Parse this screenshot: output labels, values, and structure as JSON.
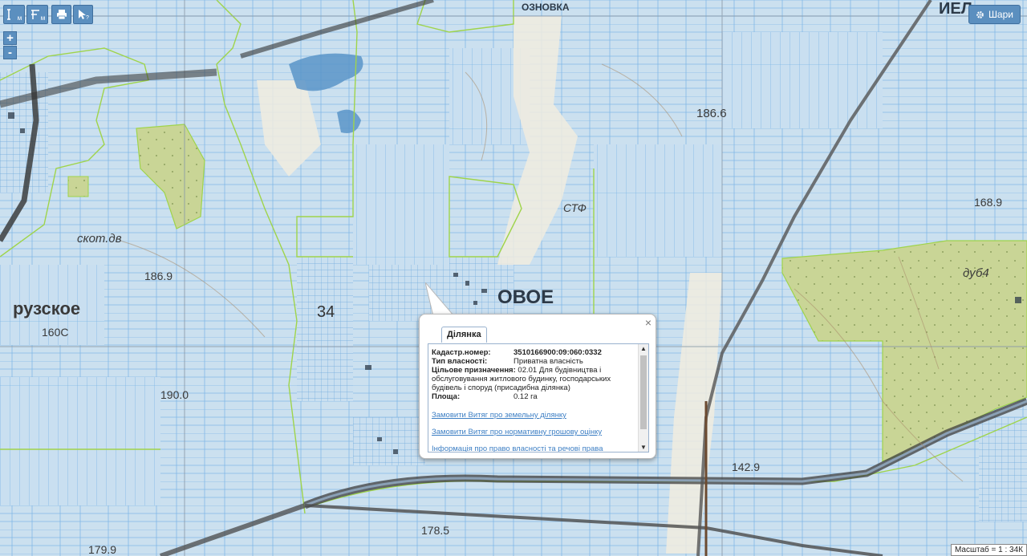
{
  "toolbar": {
    "measure_length_label": "м",
    "measure_area_label": "м",
    "icons": [
      "ruler-icon",
      "area-ruler-icon",
      "print-icon",
      "identify-icon"
    ]
  },
  "zoom": {
    "in_label": "+",
    "out_label": "-"
  },
  "layers_button": {
    "label": "Шари",
    "icon": "gear-icon"
  },
  "map_labels": [
    {
      "text": "рузское"
    },
    {
      "text": "160С"
    },
    {
      "text": "186.9"
    },
    {
      "text": "190.0"
    },
    {
      "text": "179.9"
    },
    {
      "text": "178.5"
    },
    {
      "text": "186.6"
    },
    {
      "text": "168.9"
    },
    {
      "text": "дуб4"
    },
    {
      "text": "142.9"
    },
    {
      "text": "ОВОЕ"
    },
    {
      "text": "34"
    },
    {
      "text": "СТФ"
    },
    {
      "text": "скот.дв"
    },
    {
      "text": "ИЕЛ"
    },
    {
      "text": "ОЗНОВКА"
    }
  ],
  "popup": {
    "tab_label": "Ділянка",
    "close_label": "×",
    "cadastral_label": "Кадастр.номер:",
    "cadastral_value": "3510166900:09:060:0332",
    "ownership_label": "Тип власності:",
    "ownership_value": "Приватна власність",
    "purpose_label": "Цільове призначення:",
    "purpose_value": "02.01 Для будівництва і обслуговування житлового будинку, господарських будівель і споруд (присадибна ділянка)",
    "area_label": "Площа:",
    "area_value": "0.12 га",
    "links": [
      "Замовити Витяг про земельну ділянку",
      "Замовити Витяг про нормативну грошову оцінку",
      "Інформація про право власності та речові права"
    ]
  },
  "scale": {
    "label": "Масштаб = 1 : 34К"
  },
  "colors": {
    "parcel_fill": "#c9dff0",
    "parcel_line": "#6fb1e6",
    "boundary": "#9fd44b",
    "forest": "#c9d596",
    "water": "#5b94c8",
    "road": "#4a4a4a",
    "button": "#5b8fbf",
    "link": "#3d7fc4"
  }
}
